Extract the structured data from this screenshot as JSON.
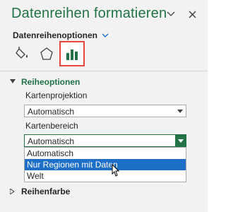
{
  "pane": {
    "title": "Datenreihen formatieren",
    "options_label": "Datenreihenoptionen",
    "options_icon": "chevron-down-icon",
    "tabs": [
      {
        "name": "fill-line-icon",
        "selected": false
      },
      {
        "name": "effects-icon",
        "selected": false
      },
      {
        "name": "series-options-icon",
        "selected": true
      }
    ]
  },
  "series_options": {
    "section_label": "Reiheoptionen",
    "projection_label": "Kartenprojektion",
    "projection_value": "Automatisch",
    "area_label": "Kartenbereich",
    "area_value": "Automatisch",
    "area_options": [
      "Automatisch",
      "Nur Regionen mit Daten",
      "Welt"
    ],
    "highlighted_option": "Nur Regionen mit Daten"
  },
  "series_color": {
    "section_label": "Reihenfarbe"
  },
  "colors": {
    "accent": "#217346",
    "highlight": "#1d6fc8",
    "tab_border": "#e8473e"
  }
}
